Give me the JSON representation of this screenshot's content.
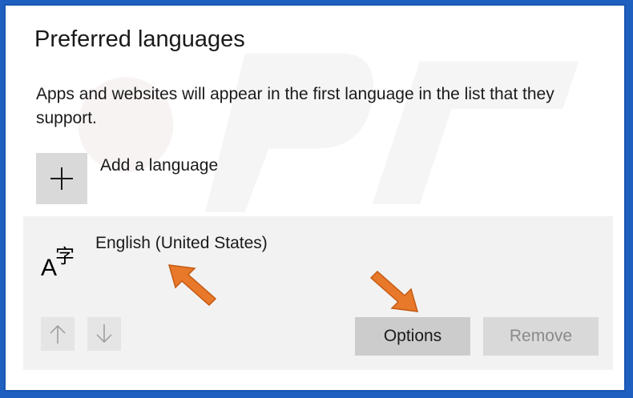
{
  "page": {
    "title": "Preferred languages",
    "description": "Apps and websites will appear in the first language in the list that they support."
  },
  "add_language": {
    "label": "Add a language",
    "icon": "plus-icon"
  },
  "languages": [
    {
      "name": "English (United States)",
      "icon": "language-icon",
      "buttons": {
        "options": "Options",
        "remove": "Remove",
        "move_up_icon": "arrow-up-icon",
        "move_down_icon": "arrow-down-icon"
      }
    }
  ],
  "annotations": {
    "arrow_color": "#e8782a"
  },
  "colors": {
    "border": "#1a56b3",
    "item_background": "#f2f2f2",
    "button_background": "#cccccc",
    "disabled_text": "#8a8a8a"
  }
}
